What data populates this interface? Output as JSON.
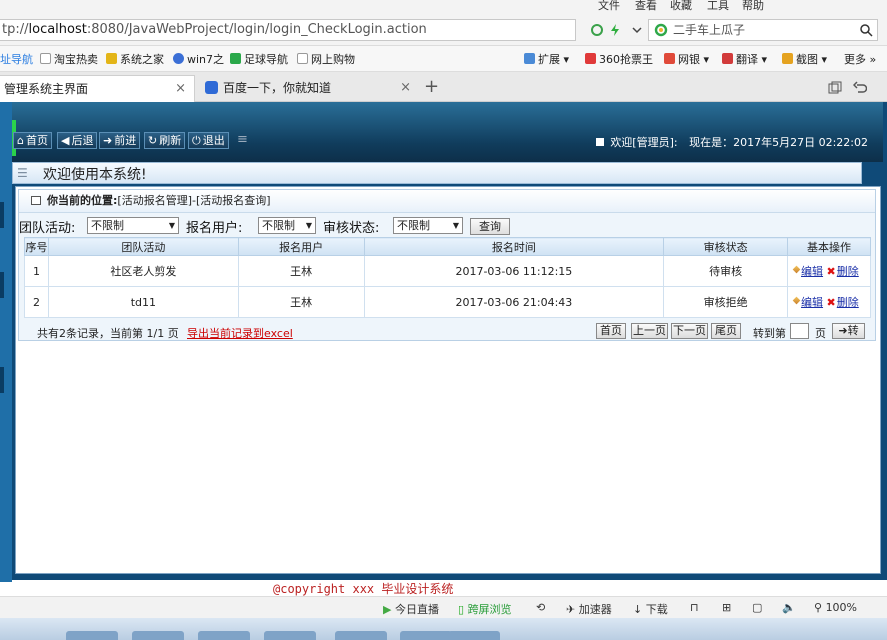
{
  "menubar": {
    "items": [
      "文件",
      "查看",
      "收藏",
      "工具",
      "帮助"
    ]
  },
  "address": {
    "url_prefix": "tp://",
    "url_host": "localhost",
    "url_rest": ":8080/JavaWebProject/login/login_CheckLogin.action",
    "search_text": "二手车上瓜子"
  },
  "bookmarks": [
    {
      "label": "址导航",
      "color": "#2a7de1"
    },
    {
      "label": "淘宝热卖",
      "color": "#f26a1b"
    },
    {
      "label": "系统之家",
      "color": "#e3b518"
    },
    {
      "label": "win7之",
      "color": "#3b6fd6"
    },
    {
      "label": "足球导航",
      "color": "#2aa84a"
    },
    {
      "label": "网上购物",
      "color": "#999999"
    },
    {
      "label": "扩展",
      "color": "#4a8ad6"
    },
    {
      "label": "360抢票王",
      "color": "#e03a3a"
    },
    {
      "label": "网银",
      "color": "#e04a3a"
    },
    {
      "label": "翻译",
      "color": "#d23b3b"
    },
    {
      "label": "截图",
      "color": "#e5a320"
    },
    {
      "label": "更多",
      "color": "#666666"
    }
  ],
  "tabs": [
    {
      "label": "管理系统主界面",
      "close": "×"
    },
    {
      "label": "百度一下，你就知道",
      "close": "×"
    }
  ],
  "tab_new": "+",
  "nav": {
    "buttons": [
      "首页",
      "后退",
      "前进",
      "刷新",
      "退出"
    ],
    "welcome": "欢迎[管理员]:",
    "now_label": "现在是：",
    "now_time": "2017年5月27日 02:22:02"
  },
  "welcome_bar": "欢迎使用本系统!",
  "position": {
    "label": "你当前的位置:",
    "path": "[活动报名管理]-[活动报名查询]"
  },
  "filters": {
    "team_label": "团队活动:",
    "team_value": "不限制",
    "user_label": "报名用户:",
    "user_value": "不限制",
    "status_label": "审核状态:",
    "status_value": "不限制",
    "query_button": "查询"
  },
  "table": {
    "headers": [
      "序号",
      "团队活动",
      "报名用户",
      "报名时间",
      "审核状态",
      "基本操作"
    ],
    "rows": [
      {
        "no": "1",
        "activity": "社区老人剪发",
        "user": "王林",
        "time": "2017-03-06 11:12:15",
        "status": "待审核",
        "edit": "编辑",
        "del": "删除"
      },
      {
        "no": "2",
        "activity": "td11",
        "user": "王林",
        "time": "2017-03-06 21:04:43",
        "status": "审核拒绝",
        "edit": "编辑",
        "del": "删除"
      }
    ]
  },
  "pager": {
    "info": "共有2条记录，当前第 1/1 页",
    "export": "导出当前记录到excel",
    "first": "首页",
    "prev": "上一页",
    "next": "下一页",
    "last": "尾页",
    "goto_label": "转到第",
    "page_unit": "页",
    "go": "转"
  },
  "copyright": "@copyright xxx 毕业设计系统",
  "statusbar": {
    "items": [
      "今日直播",
      "跨屏浏览",
      "加速器",
      "下载",
      "100%"
    ]
  },
  "colors": {
    "nav_bg": "#123f60",
    "accent_green": "#2bd24c",
    "link": "#1a2fa8",
    "export": "#cc0000"
  }
}
